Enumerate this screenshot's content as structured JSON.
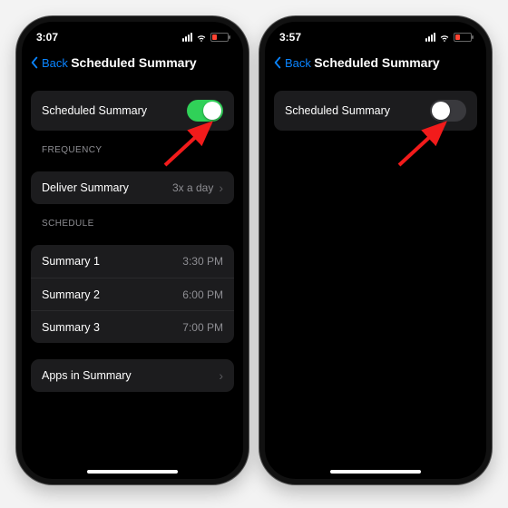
{
  "left": {
    "status_time": "3:07",
    "nav_back": "Back",
    "nav_title": "Scheduled Summary",
    "toggle_row_label": "Scheduled Summary",
    "toggle_state": "on",
    "frequency_header": "FREQUENCY",
    "deliver_label": "Deliver Summary",
    "deliver_value": "3x a day",
    "schedule_header": "SCHEDULE",
    "schedule": [
      {
        "label": "Summary 1",
        "time": "3:30 PM"
      },
      {
        "label": "Summary 2",
        "time": "6:00 PM"
      },
      {
        "label": "Summary 3",
        "time": "7:00 PM"
      }
    ],
    "apps_label": "Apps in Summary"
  },
  "right": {
    "status_time": "3:57",
    "nav_back": "Back",
    "nav_title": "Scheduled Summary",
    "toggle_row_label": "Scheduled Summary",
    "toggle_state": "off"
  }
}
